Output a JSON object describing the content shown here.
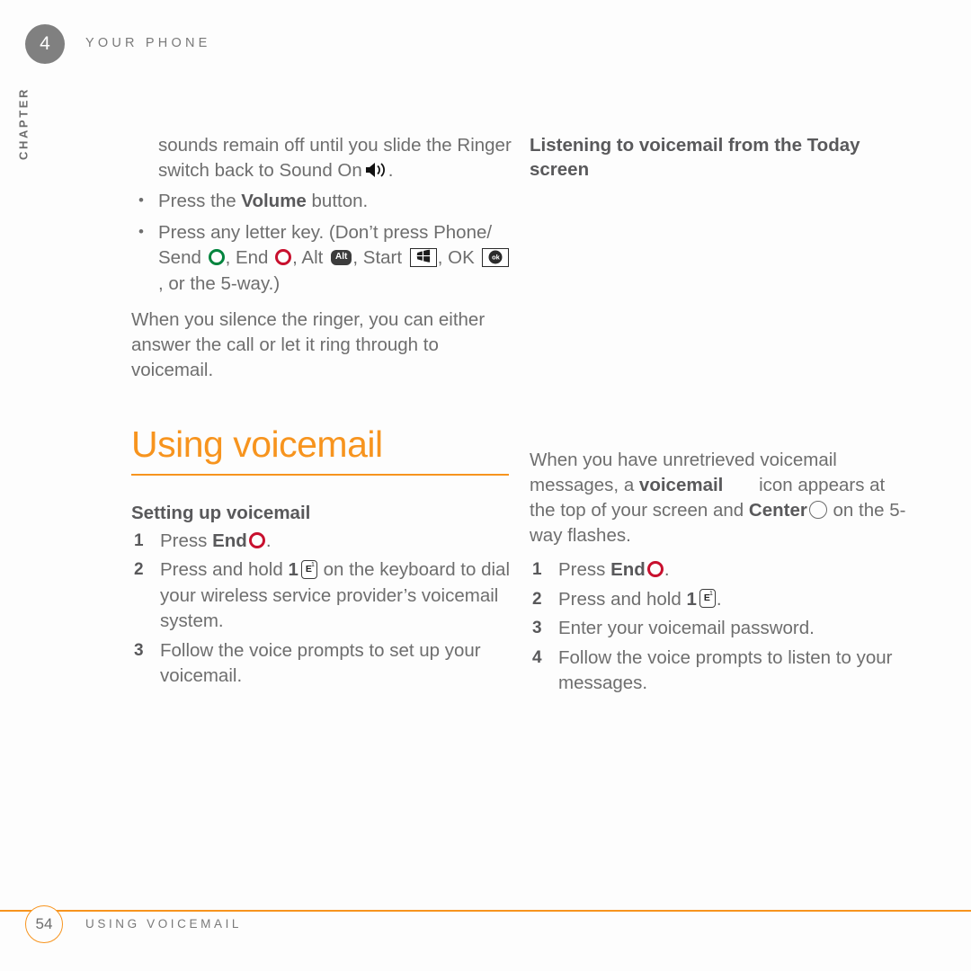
{
  "header": {
    "chapter_number": "4",
    "chapter_label": "CHAPTER",
    "title": "YOUR PHONE"
  },
  "footer": {
    "page_number": "54",
    "title": "USING VOICEMAIL"
  },
  "colors": {
    "accent_orange": "#f7941e",
    "body_gray": "#6e6e6e",
    "bold_gray": "#59595b",
    "end_red": "#c8102e",
    "send_green": "#00843d",
    "chapter_badge_gray": "#808080"
  },
  "left_column": {
    "continued_paragraph": {
      "line1": "sounds remain off until you slide the",
      "line2_pre": "Ringer switch back to Sound On",
      "line2_post": ".",
      "speaker_icon": "speaker-sound-on-icon"
    },
    "bullets": [
      {
        "pre": "Press the ",
        "bold": "Volume",
        "post": " button."
      },
      {
        "pre": "Press any letter key. (Don’t press Phone/ Send ",
        "send_icon": "phone-send-green-ring-icon",
        "mid1": ", End ",
        "end_icon": "end-red-ring-icon",
        "mid2": ", Alt ",
        "alt_icon": "alt-key-icon",
        "alt_label": "Alt",
        "mid3": ", Start ",
        "start_icon": "start-windows-key-icon",
        "mid4": ", OK ",
        "ok_icon": "ok-key-icon",
        "ok_label": "ok",
        "post": ", or the 5-way.)"
      }
    ],
    "paragraph_after": "When you silence the ringer, you can either answer the call or let it ring through to voicemail.",
    "section_title": "Using voicemail",
    "subsection_title": "Setting up voicemail",
    "steps": [
      {
        "num": "1",
        "pre": "Press ",
        "bold": "End",
        "icon": "end-red-ring-icon",
        "post": "."
      },
      {
        "num": "2",
        "pre": "Press and hold ",
        "bold": "1",
        "icon": "e1-key-icon",
        "key_letter": "E",
        "key_super": "1",
        "post": " on the keyboard to dial your wireless service provider’s voicemail system."
      },
      {
        "num": "3",
        "pre": "Follow the voice prompts to set up your voicemail.",
        "bold": "",
        "post": ""
      }
    ]
  },
  "right_column": {
    "subsection_title": "Listening to voicemail from the Today screen",
    "paragraph": {
      "p1": "When you have unretrieved voicemail messages, a ",
      "bold1": "voicemail",
      "voicemail_icon": "voicemail-status-icon",
      "p2": " icon appears at the top of your screen and ",
      "bold2": "Center",
      "center_icon": "center-ring-icon",
      "p3": " on the 5-way flashes."
    },
    "steps": [
      {
        "num": "1",
        "pre": "Press ",
        "bold": "End",
        "icon": "end-red-ring-icon",
        "post": "."
      },
      {
        "num": "2",
        "pre": "Press and hold ",
        "bold": "1",
        "icon": "e1-key-icon",
        "key_letter": "E",
        "key_super": "1",
        "post": "."
      },
      {
        "num": "3",
        "pre": "Enter your voicemail password.",
        "bold": "",
        "post": ""
      },
      {
        "num": "4",
        "pre": "Follow the voice prompts to listen to your messages.",
        "bold": "",
        "post": ""
      }
    ]
  }
}
